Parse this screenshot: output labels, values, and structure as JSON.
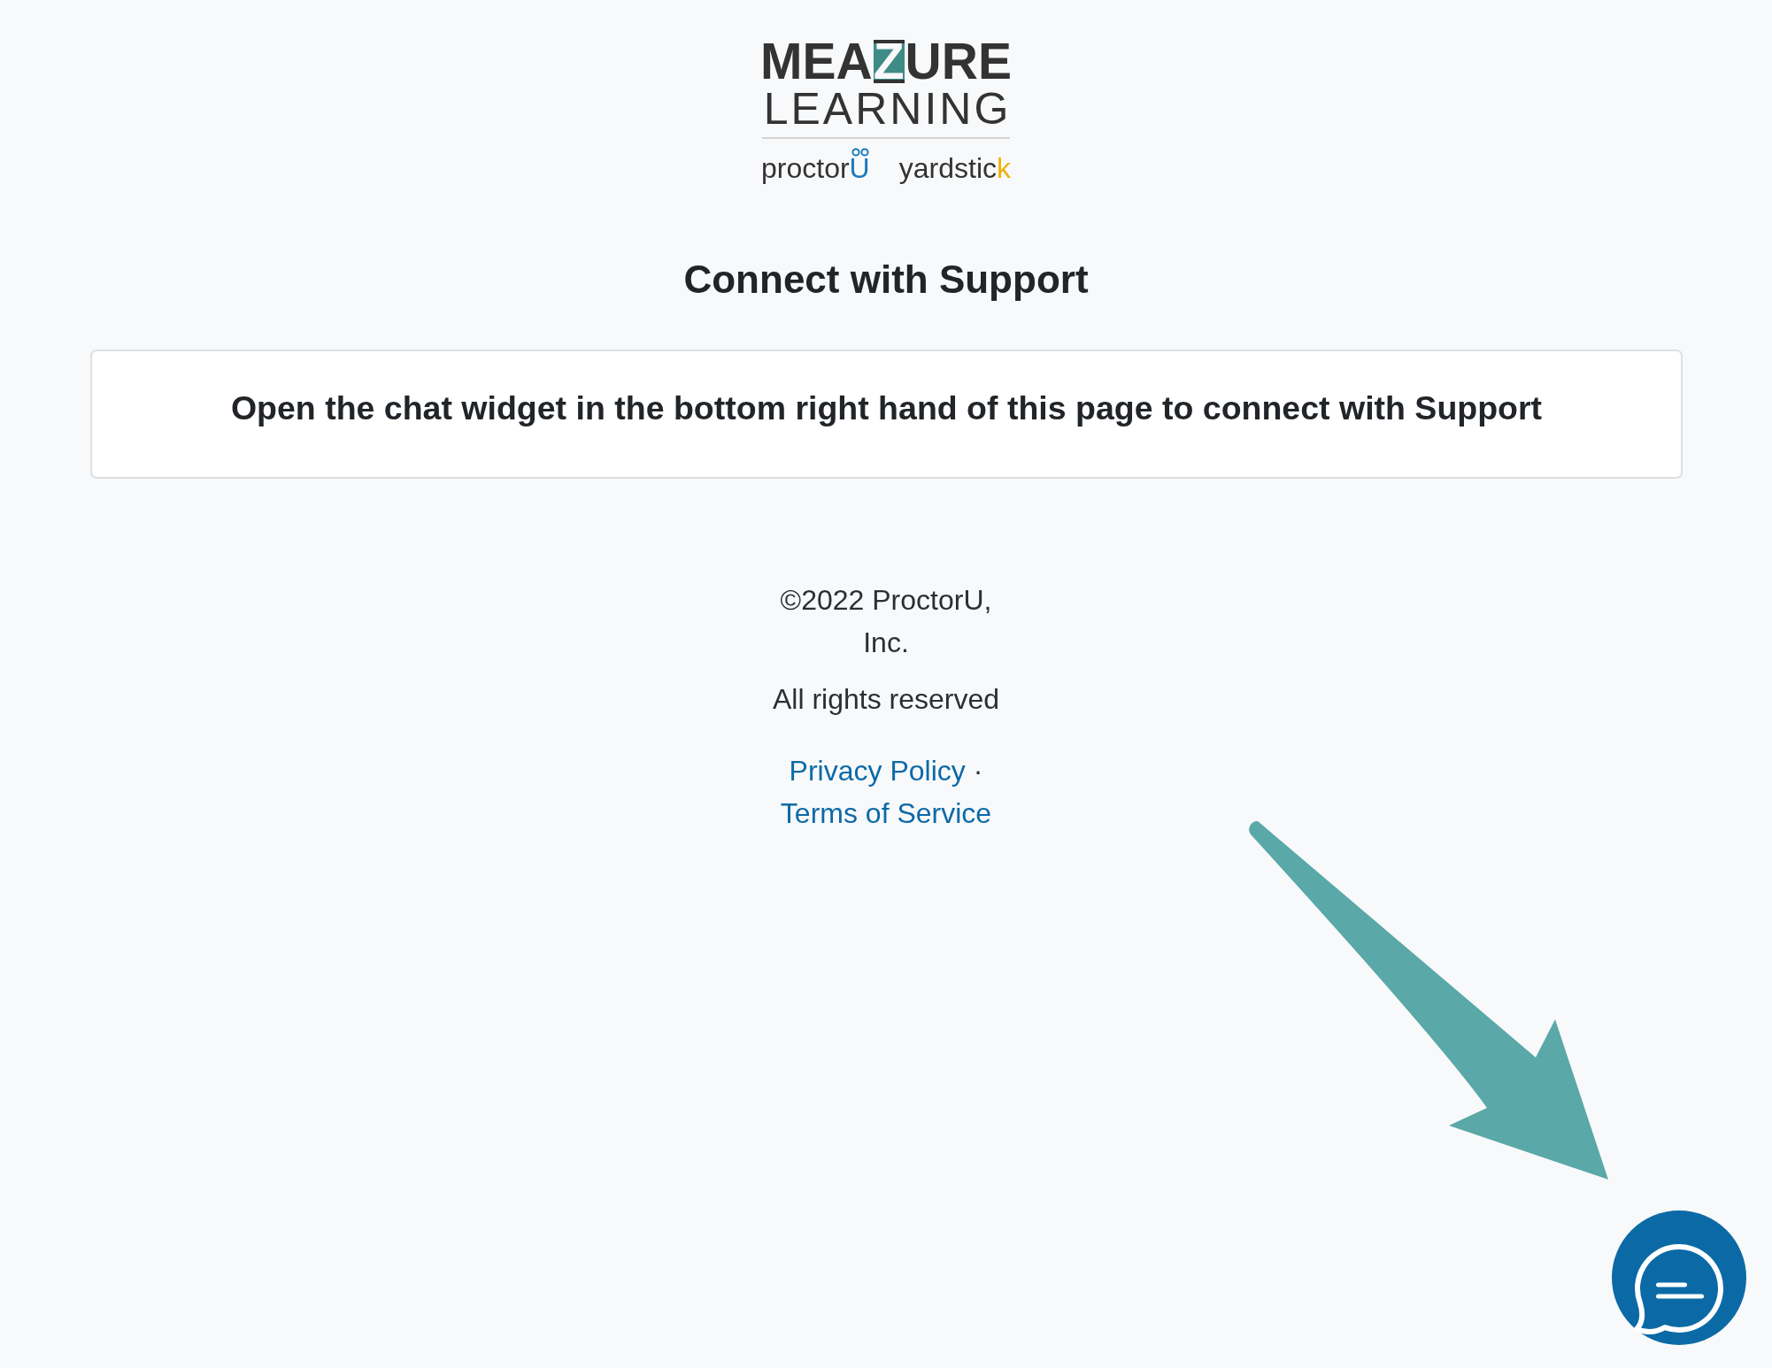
{
  "logo": {
    "wordmark": {
      "before": "MEA",
      "accent": "Z",
      "after": "URE"
    },
    "tagline": "LEARNING",
    "brands": [
      {
        "kind": "proctoru",
        "text": "proctor",
        "accent": "U"
      },
      {
        "kind": "yardstick",
        "text": "yardstic",
        "accent": "k"
      }
    ]
  },
  "heading": "Connect with Support",
  "notice": "Open the chat widget in the bottom right hand of this page to connect with Support",
  "footer": {
    "copyright": "©2022 ProctorU, Inc.",
    "rights": "All rights reserved",
    "links": [
      {
        "label": "Privacy Policy"
      },
      {
        "label": "Terms of Service"
      }
    ],
    "separator": "·"
  }
}
